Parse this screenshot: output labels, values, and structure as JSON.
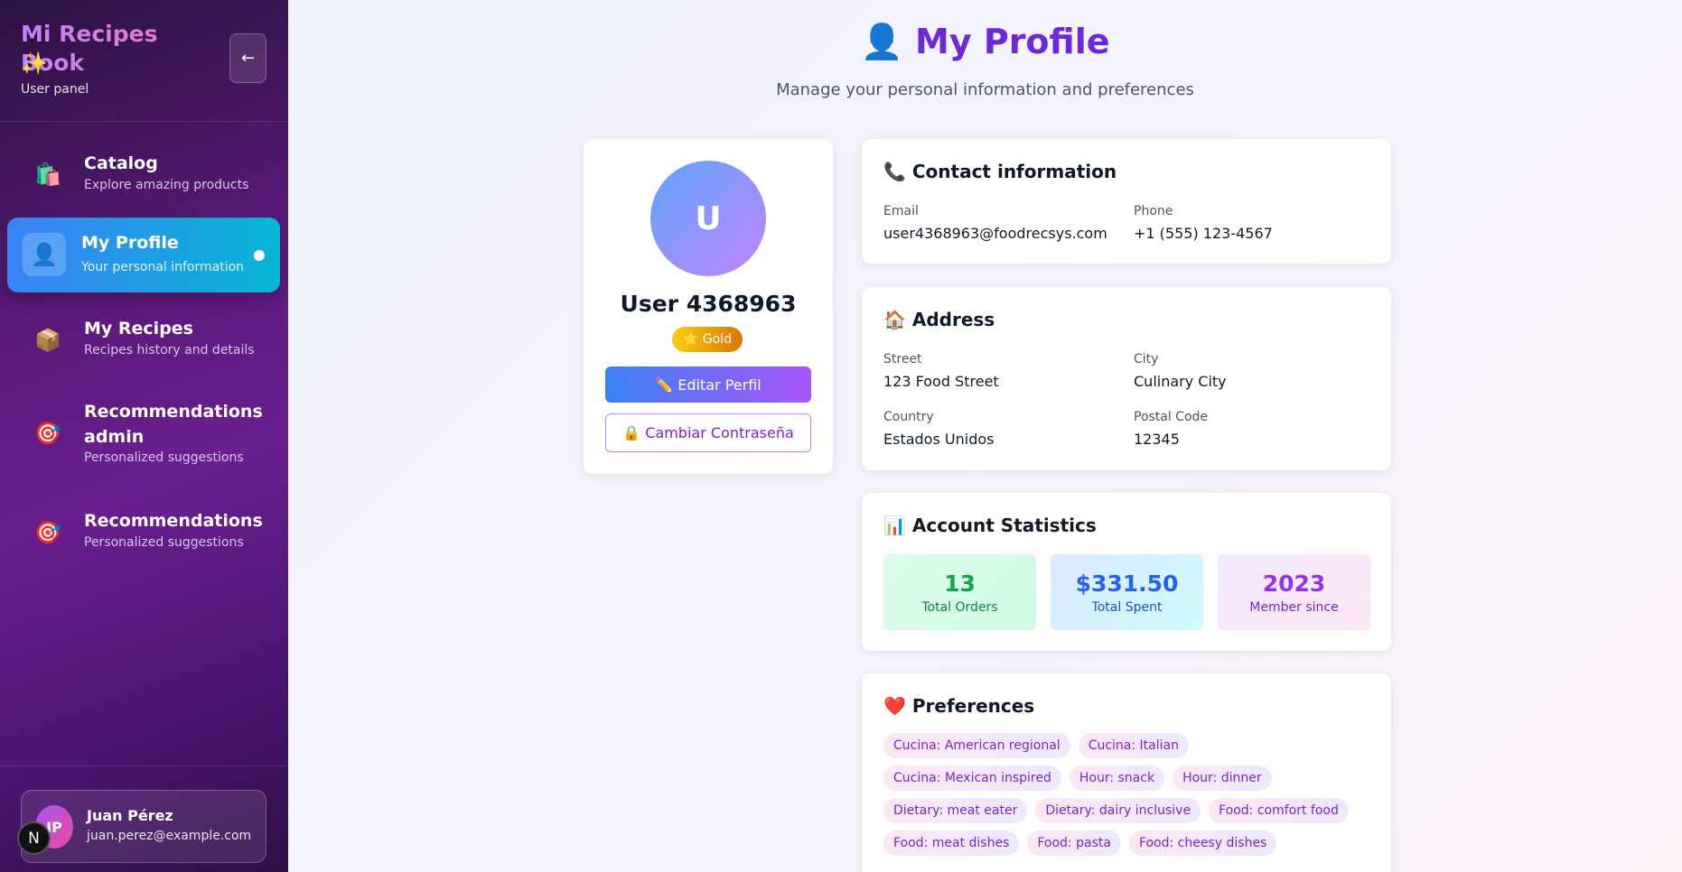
{
  "sidebar": {
    "brand": "Mi Recipes Book",
    "sparkle": "✨",
    "subtitle": "User panel",
    "collapse_icon": "←",
    "items": [
      {
        "icon": "🛍️",
        "label": "Catalog",
        "desc": "Explore amazing products"
      },
      {
        "icon": "👤",
        "label": "My Profile",
        "desc": "Your personal information"
      },
      {
        "icon": "📦",
        "label": "My Recipes",
        "desc": "Recipes history and details"
      },
      {
        "icon": "🎯",
        "label": "Recommendations admin",
        "desc": "Personalized suggestions"
      },
      {
        "icon": "🎯",
        "label": "Recommendations",
        "desc": "Personalized suggestions"
      }
    ],
    "user": {
      "initials": "JP",
      "name": "Juan Pérez",
      "email": "juan.perez@example.com"
    },
    "n_badge": "N"
  },
  "header": {
    "icon": "👤",
    "title": "My Profile",
    "subtitle": "Manage your personal information and preferences"
  },
  "profile": {
    "initial": "U",
    "name": "User 4368963",
    "tier": "⭐ Gold",
    "edit_label": "✏️ Editar Perfil",
    "password_label": "🔒 Cambiar Contraseña"
  },
  "contact": {
    "title": "📞 Contact information",
    "email_label": "Email",
    "email": "user4368963@foodrecsys.com",
    "phone_label": "Phone",
    "phone": "+1 (555) 123-4567"
  },
  "address": {
    "title": "🏠 Address",
    "street_label": "Street",
    "street": "123 Food Street",
    "city_label": "City",
    "city": "Culinary City",
    "country_label": "Country",
    "country": "Estados Unidos",
    "postal_label": "Postal Code",
    "postal": "12345"
  },
  "stats": {
    "title": "📊 Account Statistics",
    "orders": "13",
    "orders_label": "Total Orders",
    "spent": "$331.50",
    "spent_label": "Total Spent",
    "member": "2023",
    "member_label": "Member since"
  },
  "preferences": {
    "title": "❤️ Preferences",
    "tags": [
      "Cucina: American regional",
      "Cucina: Italian",
      "Cucina: Mexican inspired",
      "Hour: snack",
      "Hour: dinner",
      "Dietary: meat eater",
      "Dietary: dairy inclusive",
      "Food: comfort food",
      "Food: meat dishes",
      "Food: pasta",
      "Food: cheesy dishes"
    ]
  },
  "colors": {
    "accent": "#6d28d9",
    "active_nav": "#3b82f6",
    "sidebar": "#5a1a7a"
  }
}
